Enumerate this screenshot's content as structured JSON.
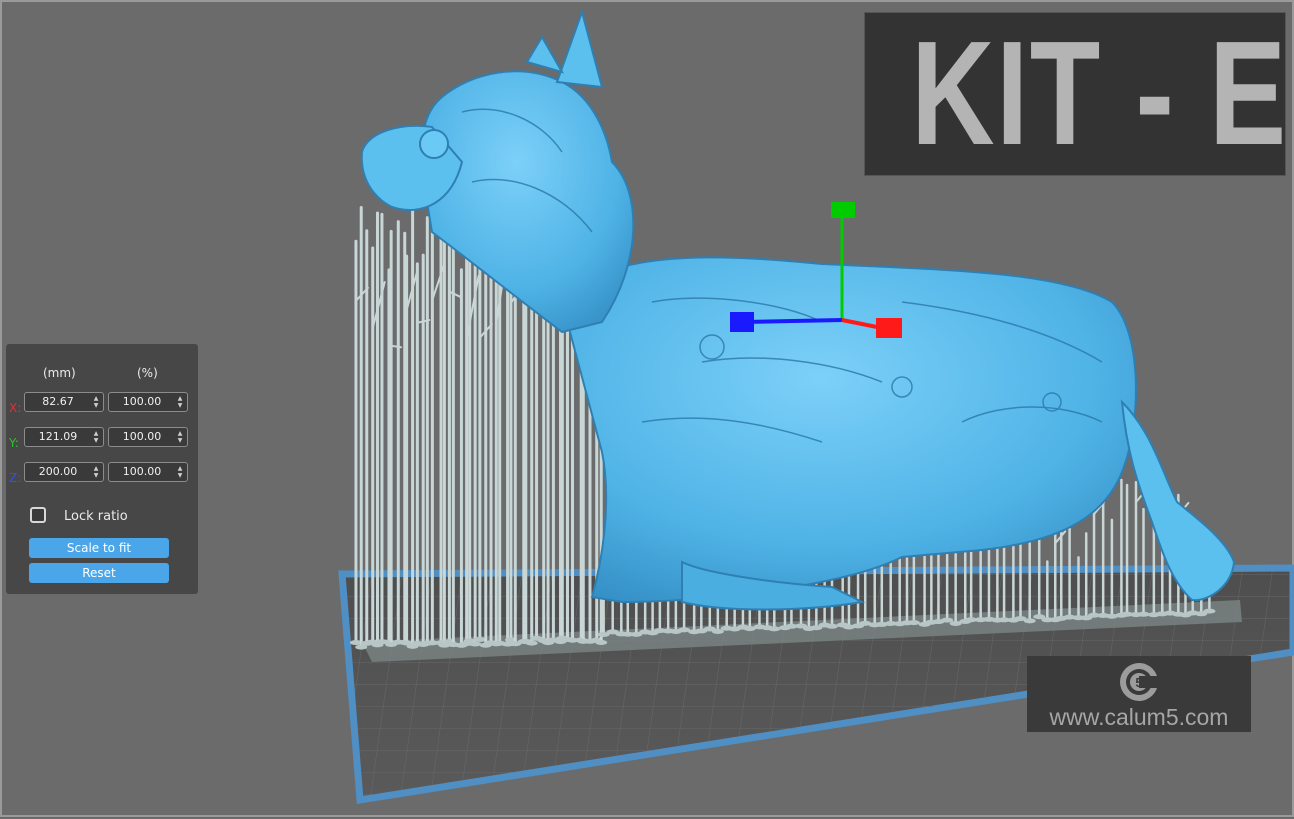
{
  "scale_panel": {
    "unit_mm": "(mm)",
    "unit_percent": "(%)",
    "axes": [
      {
        "label": "X:",
        "mm": "82.67",
        "percent": "100.00"
      },
      {
        "label": "Y:",
        "mm": "121.09",
        "percent": "100.00"
      },
      {
        "label": "Z:",
        "mm": "200.00",
        "percent": "100.00"
      }
    ],
    "lock_ratio_label": "Lock ratio",
    "lock_ratio_checked": false,
    "scale_to_fit_label": "Scale to fit",
    "reset_label": "Reset"
  },
  "banner": {
    "title": "KIT - E"
  },
  "watermark": {
    "url": "www.calum5.com",
    "logo_icon": "calum5-logo-icon"
  },
  "colors": {
    "viewport_bg": "#6b6b6b",
    "model": "#4fb3e6",
    "supports": "#c9d6d6",
    "build_plate_edge": "#4f8fc4",
    "gizmo_x": "#ff1a1a",
    "gizmo_y": "#00cc00",
    "gizmo_z": "#1a1aff",
    "button": "#4aa6e8"
  },
  "icons": [
    "gizmo-icon",
    "spin-arrows-icon",
    "checkbox-icon"
  ]
}
